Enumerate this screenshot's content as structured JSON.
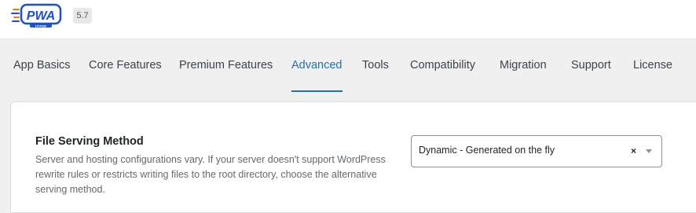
{
  "header": {
    "logo": {
      "text": "PWA",
      "subtext": "HYPER",
      "icon": "pwa-hyper-logo"
    },
    "version": "5.7"
  },
  "tabs": [
    {
      "label": "App Basics",
      "active": false
    },
    {
      "label": "Core Features",
      "active": false
    },
    {
      "label": "Premium Features",
      "active": false
    },
    {
      "label": "Advanced",
      "active": true
    },
    {
      "label": "Tools",
      "active": false
    },
    {
      "label": "Compatibility",
      "active": false
    },
    {
      "label": "Migration",
      "active": false
    },
    {
      "label": "Support",
      "active": false
    },
    {
      "label": "License",
      "active": false
    }
  ],
  "settings": {
    "file_serving": {
      "title": "File Serving Method",
      "description": "Server and hosting configurations vary. If your server doesn't support WordPress rewrite rules or restricts writing files to the root directory, choose the alternative serving method.",
      "selected": "Dynamic - Generated on the fly",
      "clear_icon": "×",
      "dropdown_icon": "chevron-down-icon"
    }
  },
  "colors": {
    "accent": "#2271b1",
    "logo_blue": "#1b4fd6",
    "logo_orange": "#f57c00"
  }
}
